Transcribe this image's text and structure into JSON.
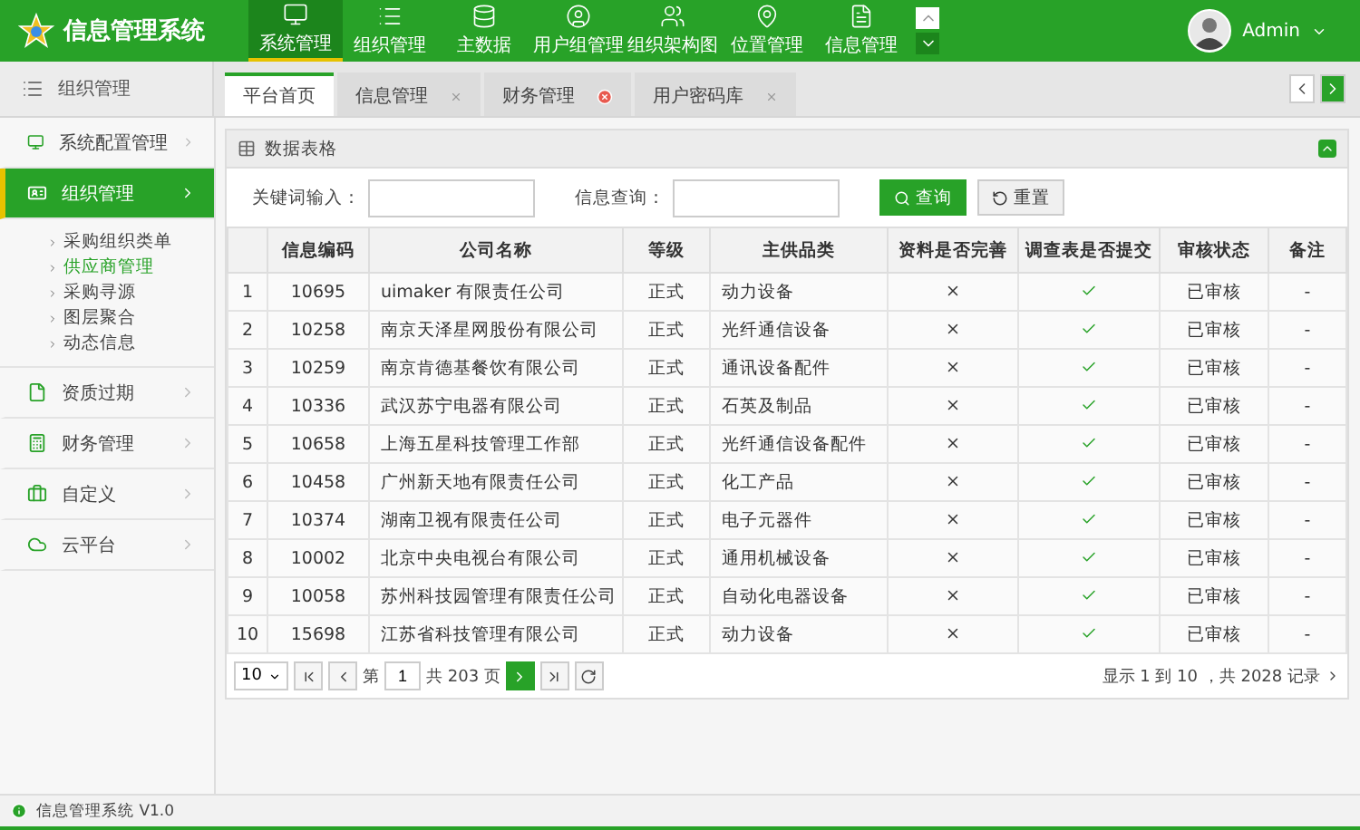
{
  "app": {
    "title": "信息管理系统",
    "user": "Admin"
  },
  "nav": [
    {
      "label": "系统管理",
      "selected": true
    },
    {
      "label": "组织管理",
      "selected": false
    },
    {
      "label": "主数据",
      "selected": false
    },
    {
      "label": "用户组管理",
      "selected": false
    },
    {
      "label": "组织架构图",
      "selected": false
    },
    {
      "label": "位置管理",
      "selected": false
    },
    {
      "label": "信息管理",
      "selected": false
    }
  ],
  "sidebar": {
    "title": "组织管理",
    "items": [
      {
        "label": "系统配置管理",
        "selected": false,
        "expanded": false
      },
      {
        "label": "组织管理",
        "selected": true,
        "expanded": true,
        "children": [
          {
            "label": "采购组织类单",
            "selected": false
          },
          {
            "label": "供应商管理",
            "selected": true
          },
          {
            "label": "采购寻源",
            "selected": false
          },
          {
            "label": "图层聚合",
            "selected": false
          },
          {
            "label": "动态信息",
            "selected": false
          }
        ]
      },
      {
        "label": "资质过期",
        "selected": false,
        "expanded": false
      },
      {
        "label": "财务管理",
        "selected": false,
        "expanded": false
      },
      {
        "label": "自定义",
        "selected": false,
        "expanded": false
      },
      {
        "label": "云平台",
        "selected": false,
        "expanded": false
      }
    ]
  },
  "tabs": [
    {
      "label": "平台首页",
      "kind": "home",
      "selected": true
    },
    {
      "label": "信息管理",
      "kind": "closable",
      "selected": false
    },
    {
      "label": "财务管理",
      "kind": "alert",
      "selected": false
    },
    {
      "label": "用户密码库",
      "kind": "closable",
      "selected": false
    }
  ],
  "panel": {
    "title": "数据表格",
    "search": [
      {
        "label": "关键词输入："
      },
      {
        "label": "信息查询："
      }
    ],
    "buttons": [
      {
        "label": "查询",
        "kind": "primary"
      },
      {
        "label": "重置",
        "kind": "reset"
      }
    ]
  },
  "table": {
    "columns": [
      "",
      "信息编码",
      "公司名称",
      "等级",
      "主供品类",
      "资料是否完善",
      "调查表是否提交",
      "审核状态",
      "备注"
    ],
    "rows": [
      {
        "index": "1",
        "code": "10695",
        "company": "uimaker 有限责任公司",
        "level": "正式",
        "category": "动力设备",
        "complete": false,
        "submitted": true,
        "status": "已审核",
        "note": "-"
      },
      {
        "index": "2",
        "code": "10258",
        "company": "南京天泽星网股份有限公司",
        "level": "正式",
        "category": "光纤通信设备",
        "complete": false,
        "submitted": true,
        "status": "已审核",
        "note": "-"
      },
      {
        "index": "3",
        "code": "10259",
        "company": "南京肯德基餐饮有限公司",
        "level": "正式",
        "category": "通讯设备配件",
        "complete": false,
        "submitted": true,
        "status": "已审核",
        "note": "-"
      },
      {
        "index": "4",
        "code": "10336",
        "company": "武汉苏宁电器有限公司",
        "level": "正式",
        "category": "石英及制品",
        "complete": false,
        "submitted": true,
        "status": "已审核",
        "note": "-"
      },
      {
        "index": "5",
        "code": "10658",
        "company": "上海五星科技管理工作部",
        "level": "正式",
        "category": "光纤通信设备配件",
        "complete": false,
        "submitted": true,
        "status": "已审核",
        "note": "-"
      },
      {
        "index": "6",
        "code": "10458",
        "company": "广州新天地有限责任公司",
        "level": "正式",
        "category": "化工产品",
        "complete": false,
        "submitted": true,
        "status": "已审核",
        "note": "-"
      },
      {
        "index": "7",
        "code": "10374",
        "company": "湖南卫视有限责任公司",
        "level": "正式",
        "category": "电子元器件",
        "complete": false,
        "submitted": true,
        "status": "已审核",
        "note": "-"
      },
      {
        "index": "8",
        "code": "10002",
        "company": "北京中央电视台有限公司",
        "level": "正式",
        "category": "通用机械设备",
        "complete": false,
        "submitted": true,
        "status": "已审核",
        "note": "-"
      },
      {
        "index": "9",
        "code": "10058",
        "company": "苏州科技园管理有限责任公司",
        "level": "正式",
        "category": "自动化电器设备",
        "complete": false,
        "submitted": true,
        "status": "已审核",
        "note": "-"
      },
      {
        "index": "10",
        "code": "15698",
        "company": "江苏省科技管理有限公司",
        "level": "正式",
        "category": "动力设备",
        "complete": false,
        "submitted": true,
        "status": "已审核",
        "note": "-"
      }
    ]
  },
  "pagination": {
    "page_size": "10",
    "page_label": "第",
    "page": "1",
    "total_pages": "共 203 页",
    "summary": "显示 1 到 10 ，共 2028 记录"
  },
  "status_bar": {
    "text": "信息管理系统 V1.0"
  }
}
